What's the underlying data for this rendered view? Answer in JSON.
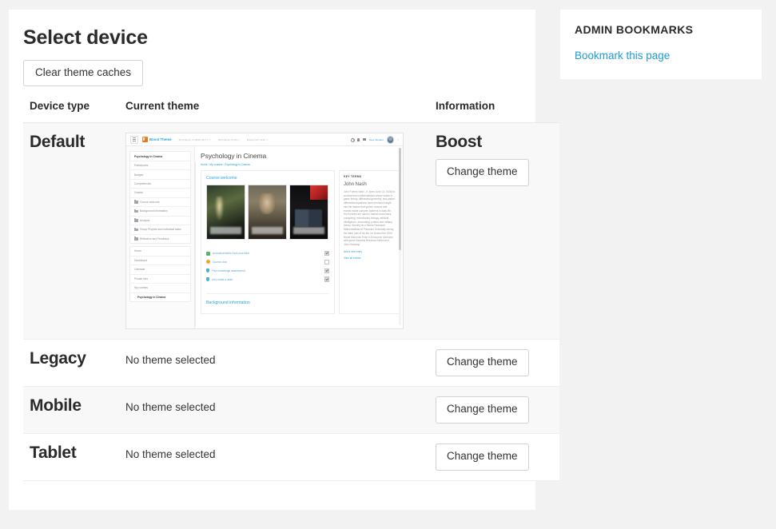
{
  "page": {
    "title": "Select device",
    "clear_cache_button": "Clear theme caches"
  },
  "table": {
    "headers": {
      "device": "Device type",
      "theme": "Current theme",
      "info": "Information"
    },
    "rows": [
      {
        "device": "Default",
        "theme_preview": true,
        "theme_text": "",
        "info_name": "Boost",
        "change_button": "Change theme"
      },
      {
        "device": "Legacy",
        "theme_preview": false,
        "theme_text": "No theme selected",
        "info_name": "",
        "change_button": "Change theme"
      },
      {
        "device": "Mobile",
        "theme_preview": false,
        "theme_text": "No theme selected",
        "info_name": "",
        "change_button": "Change theme"
      },
      {
        "device": "Tablet",
        "theme_preview": false,
        "theme_text": "No theme selected",
        "info_name": "",
        "change_button": "Change theme"
      }
    ]
  },
  "sidebar": {
    "admin_bookmarks_title": "ADMIN BOOKMARKS",
    "bookmark_link": "Bookmark this page"
  },
  "theme_preview": {
    "navbar": {
      "brand": "Boost Theme",
      "items": [
        "MOODLE COMMUNITY",
        "MOODLE.COM",
        "ENGLISH (EN)"
      ],
      "user": "Jane Student",
      "icons": [
        "search-icon",
        "bell-icon",
        "message-icon",
        "avatar"
      ]
    },
    "course": {
      "title": "Psychology in Cinema",
      "breadcrumb": [
        "Home",
        "My courses",
        "Psychology in Cinema"
      ]
    },
    "nav_menu_primary": [
      "Psychology in Cinema",
      "Participants",
      "Badges",
      "Competencies",
      "Grades",
      "Course welcome",
      "Background information",
      "Analysis",
      "Group Projects and individual tasks",
      "Reflection and Feedback"
    ],
    "nav_menu_secondary": [
      "Home",
      "Dashboard",
      "Calendar",
      "Private files",
      "My courses",
      "Psychology in Cinema"
    ],
    "section_title": "Course welcome",
    "activities": [
      {
        "label": "Announcements from your tutor",
        "icon": "forum-icon",
        "checked": true
      },
      {
        "label": "Course chat",
        "icon": "chat-icon",
        "checked": false
      },
      {
        "label": "Prior knowledge assessment",
        "icon": "questionnaire-icon",
        "checked": true
      },
      {
        "label": "Let's make a date!",
        "icon": "questionnaire-icon",
        "checked": true
      }
    ],
    "next_section_title": "Background information",
    "key_terms": {
      "title": "KEY TERMS",
      "entry_name": "John Nash",
      "entry_body": "John Forbes Nash, Jr. (born June 13, 1928) is an American mathematician whose works in game theory, differential geometry, and partial differential equations have provided insight into the factors that govern chance and events inside complex systems in daily life. His theories are used in market economics, computing, evolutionary biology, artificial intelligence, accounting, politics and military theory. Serving as a Senior Research Mathematician at Princeton University during the latter part of his life, he shared the 1994 Nobel Memorial Prize in Economic Sciences with game theorists Reinhard Selten and John Harsanyi.",
      "links": [
        "Add a new entry",
        "View all entries"
      ]
    }
  },
  "colors": {
    "page_background": "#f2f2f2",
    "panel": "#ffffff",
    "link": "#1e9bd7",
    "text": "#2b2b2b",
    "row_alt": "#f8f8f8",
    "border": "#e8e8e8"
  }
}
